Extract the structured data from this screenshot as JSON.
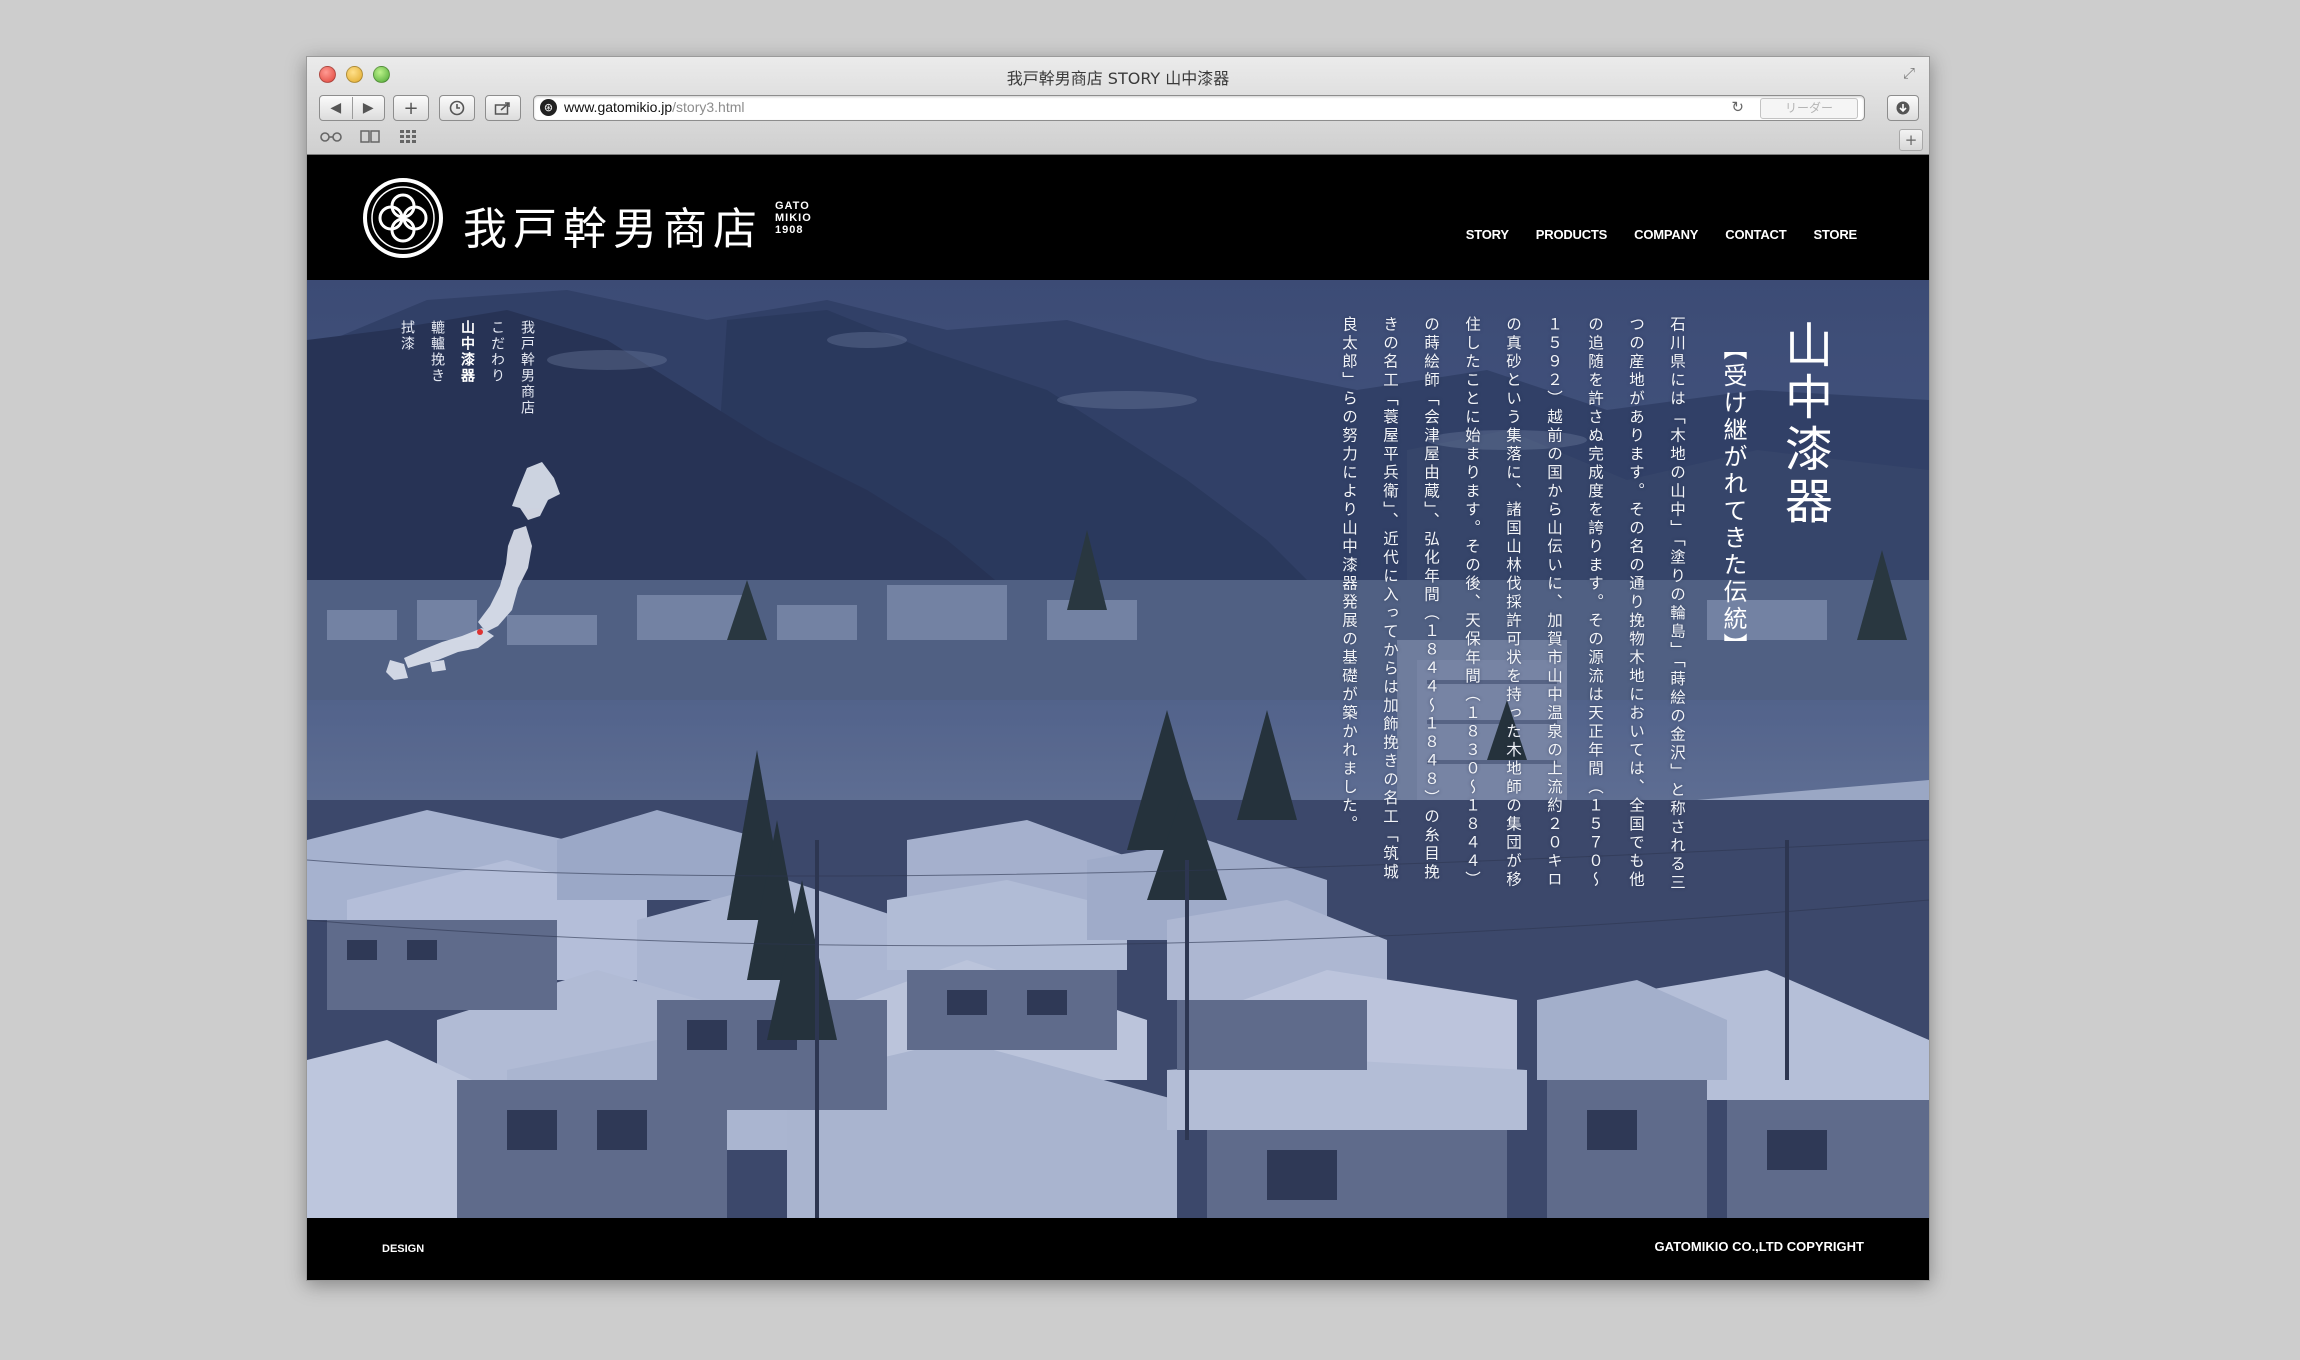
{
  "window": {
    "title": "我戸幹男商店 STORY 山中漆器"
  },
  "toolbar": {
    "back_label": "◀",
    "forward_label": "▶",
    "add_label": "+",
    "history_icon": "clock-icon",
    "share_icon": "share-icon"
  },
  "address": {
    "url_domain": "www.gatomikio.jp",
    "url_path": "/story3.html",
    "reader_label": "リーダー"
  },
  "site": {
    "logo_text": "我戸幹男商店",
    "logo_sub": [
      "GATO",
      "MIKIO",
      "1908"
    ],
    "nav": [
      {
        "label": "STORY"
      },
      {
        "label": "PRODUCTS"
      },
      {
        "label": "COMPANY"
      },
      {
        "label": "CONTACT"
      },
      {
        "label": "STORE"
      }
    ],
    "side_menu": [
      {
        "label": "我戸幹男商店"
      },
      {
        "label": "こだわり"
      },
      {
        "label": "山中漆器",
        "active": true
      },
      {
        "label": "轆轤挽き"
      },
      {
        "label": "拭漆"
      }
    ]
  },
  "story": {
    "title": "山中漆器",
    "subtitle": "【受け継がれてきた伝統】",
    "body": "石川県には「木地の山中」「塗りの輪島」「蒔絵の金沢」と称される三つの産地があります。その名の通り挽物木地においては、全国でも他の追随を許さぬ完成度を誇ります。その源流は天正年間（１５７０〜１５９２）越前の国から山伝いに、加賀市山中温泉の上流約２０キロの真砂という集落に、諸国山林伐採許可状を持った木地師の集団が移住したことに始まります。その後、天保年間（１８３０〜１８４４）の蒔絵師「会津屋由蔵」、弘化年間（１８４４〜１８４８）の糸目挽きの名工「蓑屋平兵衛」、近代に入ってからは加飾挽きの名工「筑城良太郎」らの努力により山中漆器発展の基礎が築かれました。"
  },
  "footer": {
    "left": "DESIGN",
    "right": "GATOMIKIO CO.,LTD COPYRIGHT"
  }
}
